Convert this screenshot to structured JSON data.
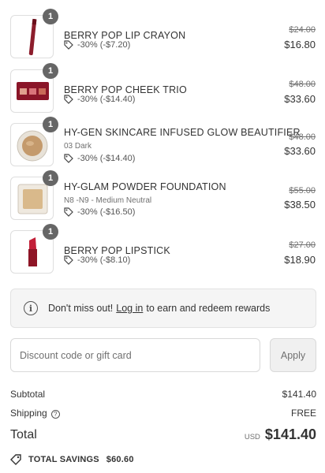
{
  "items": [
    {
      "qty": "1",
      "name": "BERRY POP LIP CRAYON",
      "variant": "",
      "discount": "-30% (-$7.20)",
      "original": "$24.00",
      "price": "$16.80",
      "thumb_icon": "lip-crayon-image"
    },
    {
      "qty": "1",
      "name": "BERRY POP CHEEK TRIO",
      "variant": "",
      "discount": "-30% (-$14.40)",
      "original": "$48.00",
      "price": "$33.60",
      "thumb_icon": "cheek-trio-palette-image"
    },
    {
      "qty": "1",
      "name": "HY-GEN SKINCARE INFUSED GLOW BEAUTIFIER",
      "variant": "03 Dark",
      "discount": "-30% (-$14.40)",
      "original": "$48.00",
      "price": "$33.60",
      "thumb_icon": "glow-beautifier-image"
    },
    {
      "qty": "1",
      "name": "HY-GLAM POWDER FOUNDATION",
      "variant": "N8 -N9 - Medium Neutral",
      "discount": "-30% (-$16.50)",
      "original": "$55.00",
      "price": "$38.50",
      "thumb_icon": "powder-foundation-image"
    },
    {
      "qty": "1",
      "name": "BERRY POP LIPSTICK",
      "variant": "",
      "discount": "-30% (-$8.10)",
      "original": "$27.00",
      "price": "$18.90",
      "thumb_icon": "lipstick-image"
    }
  ],
  "rewards": {
    "prefix": "Don't miss out!",
    "link": "Log in",
    "suffix": "to earn and redeem rewards"
  },
  "discount": {
    "placeholder": "Discount code or gift card",
    "apply_label": "Apply"
  },
  "summary": {
    "subtotal_label": "Subtotal",
    "subtotal_value": "$141.40",
    "shipping_label": "Shipping",
    "shipping_value": "FREE",
    "total_label": "Total",
    "currency": "USD",
    "total_value": "$141.40",
    "savings_label": "TOTAL SAVINGS",
    "savings_value": "$60.60"
  },
  "colors": {
    "qty_badge": "#666666",
    "lip_crayon": "#8c1d2c",
    "lipstick": "#a3182c",
    "palette": "#8a1528"
  }
}
